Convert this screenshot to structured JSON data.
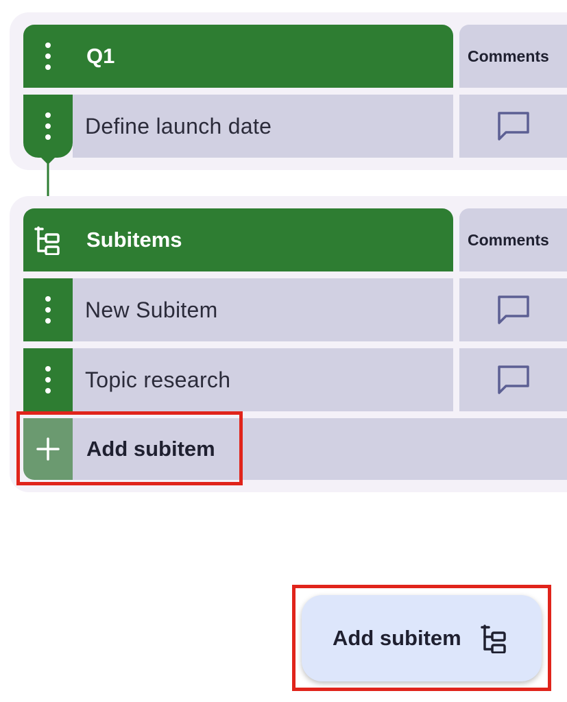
{
  "colors": {
    "group_green": "#2e7d32",
    "cell_lavender": "#d1d0e2",
    "comment_icon": "#5c5f93",
    "highlight_red": "#e0241b",
    "fab_background": "#dde6fb"
  },
  "parent_group": {
    "title": "Q1",
    "column_header": "Comments",
    "menu_icon": "more-vert-icon",
    "items": [
      {
        "name": "Define launch date",
        "comment_icon": "comment-icon"
      }
    ]
  },
  "subitems_group": {
    "title": "Subitems",
    "title_icon": "subitems-tree-icon",
    "column_header": "Comments",
    "items": [
      {
        "name": "New Subitem",
        "comment_icon": "comment-icon"
      },
      {
        "name": "Topic research",
        "comment_icon": "comment-icon"
      }
    ],
    "add_row": {
      "label": "Add subitem",
      "icon": "plus-icon"
    }
  },
  "fab": {
    "label": "Add subitem",
    "icon": "subitems-tree-icon"
  }
}
